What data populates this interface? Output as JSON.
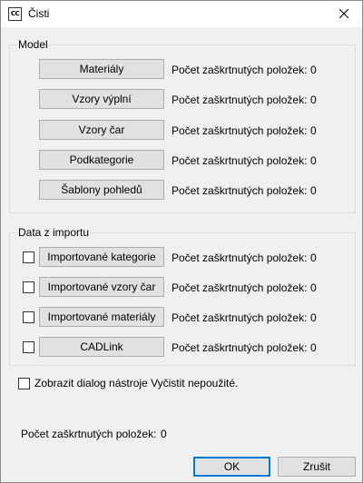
{
  "window": {
    "title": "Čisti",
    "icon_text": "CC"
  },
  "model_group": {
    "label": "Model",
    "rows": [
      {
        "button": "Materiály",
        "count_label": "Počet zaškrtnutých položek:",
        "count": "0"
      },
      {
        "button": "Vzory výplní",
        "count_label": "Počet zaškrtnutých položek:",
        "count": "0"
      },
      {
        "button": "Vzory čar",
        "count_label": "Počet zaškrtnutých položek:",
        "count": "0"
      },
      {
        "button": "Podkategorie",
        "count_label": "Počet zaškrtnutých položek:",
        "count": "0"
      },
      {
        "button": "Šablony pohledů",
        "count_label": "Počet zaškrtnutých položek:",
        "count": "0"
      }
    ]
  },
  "import_group": {
    "label": "Data z importu",
    "rows": [
      {
        "button": "Importované kategorie",
        "checked": false,
        "count_label": "Počet zaškrtnutých položek:",
        "count": "0"
      },
      {
        "button": "Importované vzory čar",
        "checked": false,
        "count_label": "Počet zaškrtnutých položek:",
        "count": "0"
      },
      {
        "button": "Importované materiály",
        "checked": false,
        "count_label": "Počet zaškrtnutých položek:",
        "count": "0"
      },
      {
        "button": "CADLink",
        "checked": false,
        "count_label": "Počet zaškrtnutých položek:",
        "count": "0"
      }
    ]
  },
  "show_dialog": {
    "label": "Zobrazit dialog nástroje Vyčistit nepoužité.",
    "checked": false
  },
  "total": {
    "label": "Počet zaškrtnutých položek:",
    "value": "0"
  },
  "footer": {
    "ok_label": "OK",
    "cancel_label": "Zrušit"
  }
}
